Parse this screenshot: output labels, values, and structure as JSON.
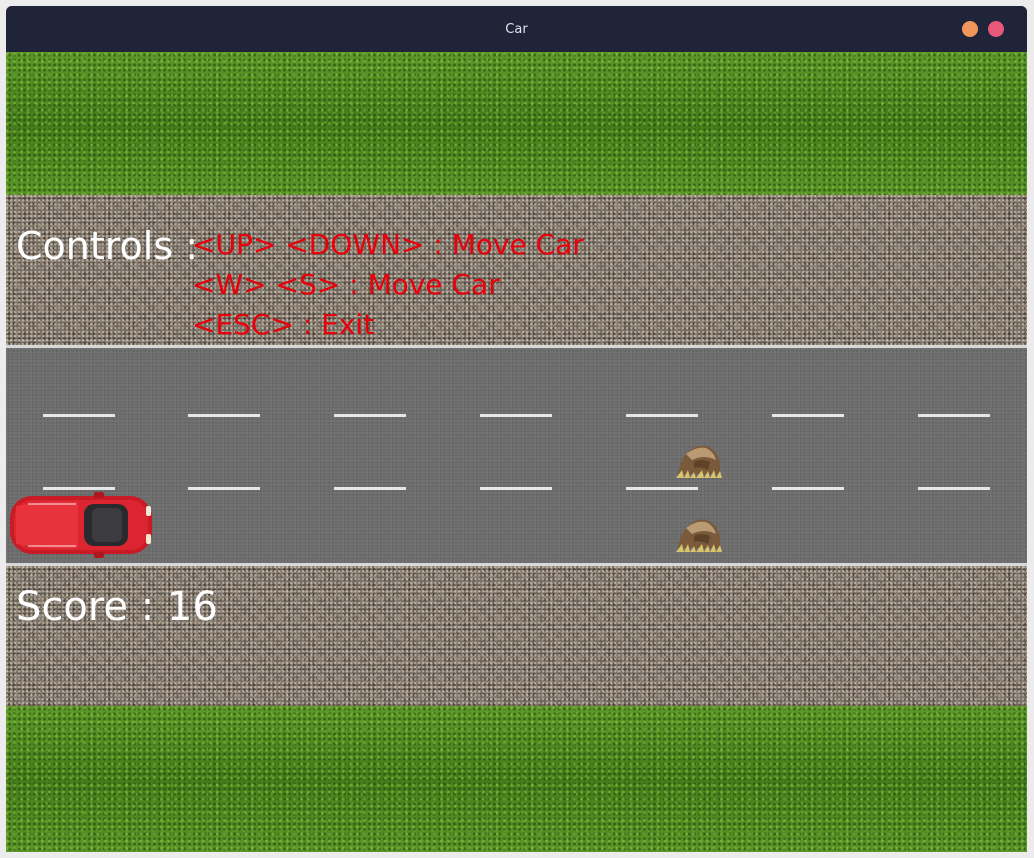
{
  "window": {
    "title": "Car",
    "buttons": [
      {
        "name": "minimize",
        "color": "#f0965a"
      },
      {
        "name": "close",
        "color": "#e8587a"
      }
    ]
  },
  "hud": {
    "controls_label": "Controls :",
    "controls_lines": [
      "<UP> <DOWN> : Move Car",
      "<W> <S> : Move Car",
      "<ESC> : Exit"
    ],
    "score_label": "Score : ",
    "score_value": "16"
  },
  "scene": {
    "player": "red car",
    "obstacles": [
      "rock",
      "rock"
    ],
    "colors": {
      "controls_text": "#e8000b",
      "label_text": "#ffffff",
      "car_body": "#d8202c"
    }
  }
}
